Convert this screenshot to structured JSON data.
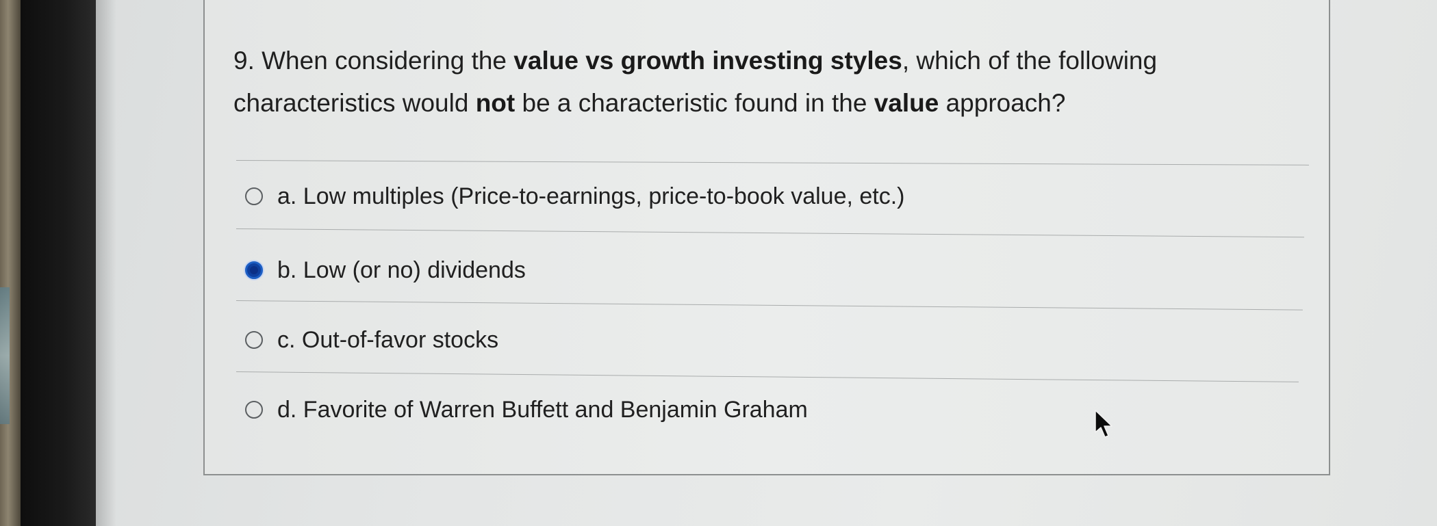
{
  "question": {
    "parts": [
      {
        "text": "9. When considering the ",
        "bold": false
      },
      {
        "text": "value vs growth investing styles",
        "bold": true
      },
      {
        "text": ", which of the following characteristics would ",
        "bold": false
      },
      {
        "text": "not",
        "bold": true
      },
      {
        "text": " be a characteristic found in the ",
        "bold": false
      },
      {
        "text": "value",
        "bold": true
      },
      {
        "text": " approach?",
        "bold": false
      }
    ]
  },
  "options": [
    {
      "label": "a. Low multiples (Price-to-earnings, price-to-book value, etc.)",
      "selected": false
    },
    {
      "label": "b. Low (or no) dividends",
      "selected": true
    },
    {
      "label": "c. Out-of-favor stocks",
      "selected": false
    },
    {
      "label": "d. Favorite of Warren Buffett and Benjamin Graham",
      "selected": false
    }
  ],
  "colors": {
    "selected_radio": "#0e3f9e",
    "text": "#1f1f1f"
  },
  "icons": {
    "pointer": "mouse-pointer-icon",
    "radio_empty": "radio-unselected-icon",
    "radio_filled": "radio-selected-icon"
  }
}
